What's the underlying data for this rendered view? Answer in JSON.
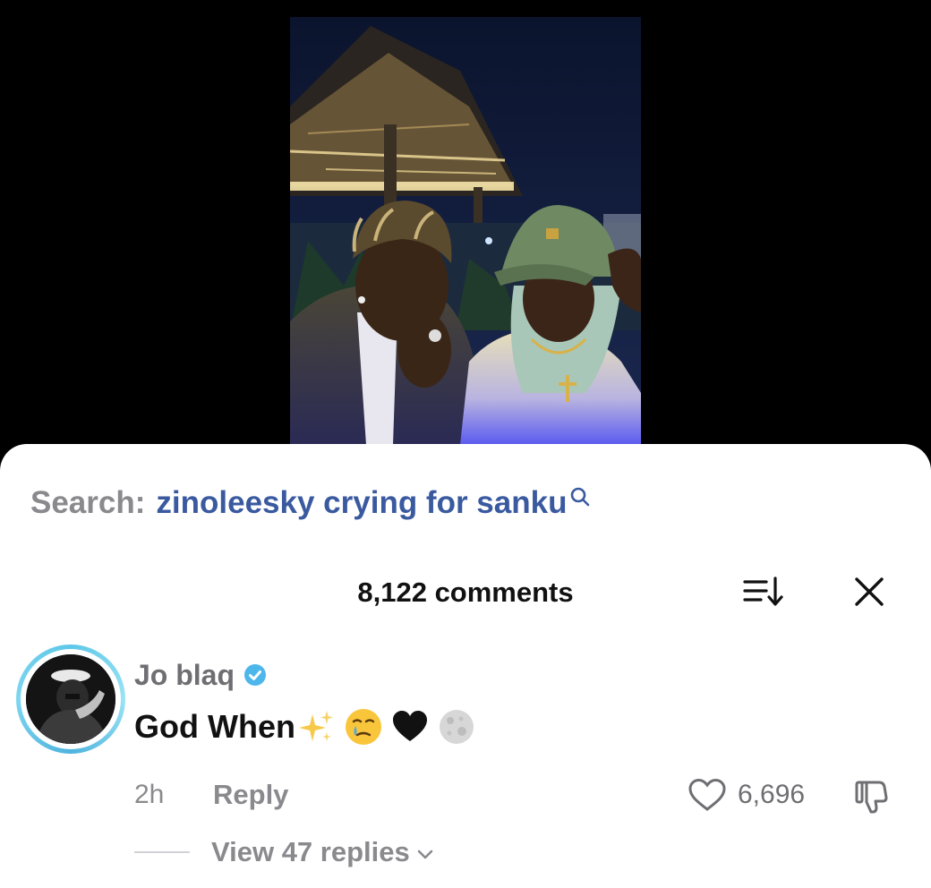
{
  "video": {
    "scene": "night photo of two people under a thatched gazebo"
  },
  "search": {
    "prefix": "Search:",
    "query": "zinoleesky crying for sanku",
    "icon": "search-icon"
  },
  "comments_header": {
    "count_label": "8,122 comments",
    "sort_icon": "sort-icon",
    "close_icon": "close-icon"
  },
  "comment": {
    "username": "Jo blaq",
    "verified": true,
    "text": "God When",
    "emojis": [
      "sparkles",
      "crying-face",
      "black-heart",
      "full-moon"
    ],
    "time": "2h",
    "reply_label": "Reply",
    "like_count": "6,696",
    "view_replies_label": "View 47 replies"
  },
  "colors": {
    "accent_link": "#3a5aa0",
    "muted_text": "#8a8a8e",
    "verified_blue": "#4db6ea",
    "avatar_ring": "#5ec8e8"
  }
}
